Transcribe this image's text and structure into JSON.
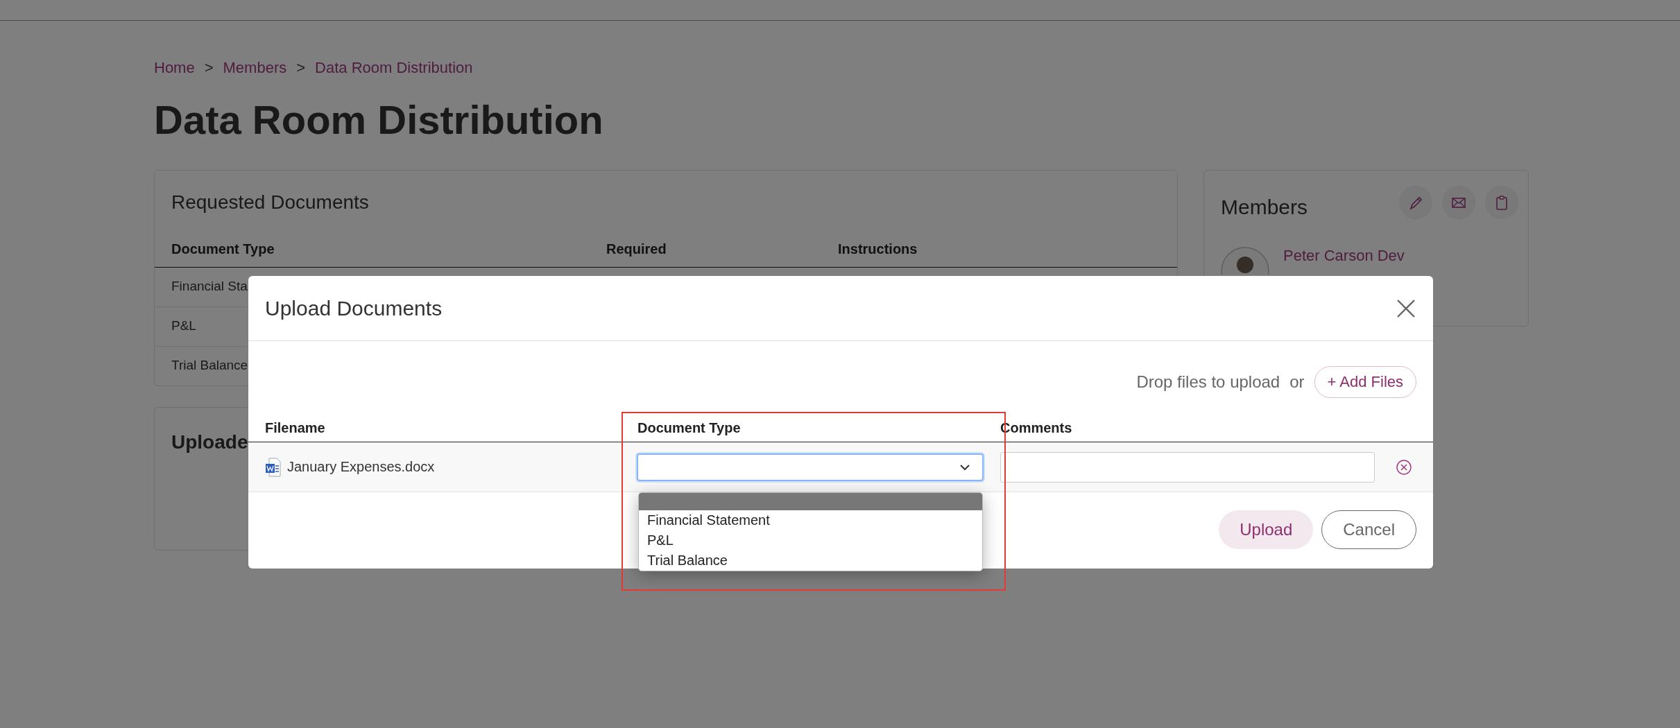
{
  "breadcrumb": [
    {
      "kind": "link",
      "label": "Home"
    },
    {
      "kind": "separator",
      "label": ">"
    },
    {
      "kind": "link",
      "label": "Members"
    },
    {
      "kind": "separator",
      "label": ">"
    },
    {
      "kind": "link",
      "label": "Data Room Distribution"
    }
  ],
  "page_title": "Data Room Distribution",
  "requested_documents": {
    "title": "Requested Documents",
    "columns": [
      "Document Type",
      "Required",
      "Instructions"
    ],
    "rows": [
      "Financial Sta",
      "P&L",
      "Trial Balance"
    ]
  },
  "uploaded_card": {
    "title": "Uploade"
  },
  "members": {
    "title": "Members",
    "member": {
      "name": "Peter Carson Dev"
    }
  },
  "modal": {
    "title": "Upload Documents",
    "drop_hint": "Drop files to upload",
    "or": "or",
    "add_files": "+ Add Files",
    "columns": [
      "Filename",
      "Document Type",
      "Comments"
    ],
    "files": [
      {
        "filename": "January Expenses.docx",
        "document_type": {
          "open": true,
          "options": [
            {
              "selected": true
            },
            {
              "label": "Financial Statement",
              "selected": false
            },
            {
              "label": "P&L",
              "selected": false
            },
            {
              "label": "Trial Balance",
              "selected": false
            }
          ]
        }
      }
    ],
    "buttons": [
      {
        "kind": "primary",
        "label": "Upload"
      },
      {
        "kind": "secondary",
        "label": "Cancel"
      }
    ]
  }
}
